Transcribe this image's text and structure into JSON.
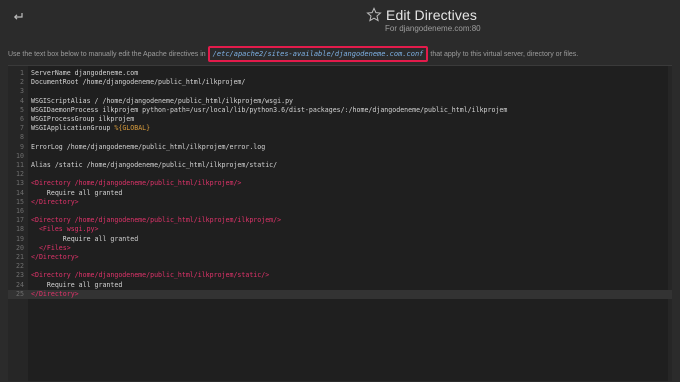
{
  "header": {
    "back_icon": "back-arrow-icon",
    "title": "Edit Directives",
    "star_icon": "star-outline-icon",
    "subtitle": "For djangodeneme.com:80"
  },
  "description": {
    "before": "Use the text box below to manually edit the Apache directives in",
    "path": "/etc/apache2/sites-available/djangodeneme.com.conf",
    "after": "that apply to this virtual server, directory or files."
  },
  "editor": {
    "lines": [
      {
        "n": "1",
        "text": "ServerName djangodeneme.com",
        "kind": "text"
      },
      {
        "n": "2",
        "text": "DocumentRoot /home/djangodeneme/public_html/ilkprojem/",
        "kind": "text"
      },
      {
        "n": "3",
        "text": "",
        "kind": "text"
      },
      {
        "n": "4",
        "text": "WSGIScriptAlias / /home/djangodeneme/public_html/ilkprojem/wsgi.py",
        "kind": "text"
      },
      {
        "n": "5",
        "text": "WSGIDaemonProcess ilkprojem python-path=/usr/local/lib/python3.6/dist-packages/:/home/djangodeneme/public_html/ilkprojem",
        "kind": "text"
      },
      {
        "n": "6",
        "text": "WSGIProcessGroup ilkprojem",
        "kind": "text"
      },
      {
        "n": "7",
        "text": "WSGIApplicationGroup ",
        "var": "%{GLOBAL}",
        "kind": "text"
      },
      {
        "n": "8",
        "text": "",
        "kind": "text"
      },
      {
        "n": "9",
        "text": "ErrorLog /home/djangodeneme/public_html/ilkprojem/error.log",
        "kind": "text"
      },
      {
        "n": "10",
        "text": "",
        "kind": "text"
      },
      {
        "n": "11",
        "text": "Alias /static /home/djangodeneme/public_html/ilkprojem/static/",
        "kind": "text"
      },
      {
        "n": "12",
        "text": "",
        "kind": "text"
      },
      {
        "n": "13",
        "text": "<Directory /home/djangodeneme/public_html/ilkprojem/>",
        "kind": "tag"
      },
      {
        "n": "14",
        "text": "    Require all granted",
        "kind": "text"
      },
      {
        "n": "15",
        "text": "</Directory>",
        "kind": "tag"
      },
      {
        "n": "16",
        "text": "",
        "kind": "text"
      },
      {
        "n": "17",
        "text": "<Directory /home/djangodeneme/public_html/ilkprojem/ilkprojem/>",
        "kind": "tag"
      },
      {
        "n": "18",
        "text": "  <Files wsgi.py>",
        "kind": "tag"
      },
      {
        "n": "19",
        "text": "        Require all granted",
        "kind": "text"
      },
      {
        "n": "20",
        "text": "  </Files>",
        "kind": "tag"
      },
      {
        "n": "21",
        "text": "</Directory>",
        "kind": "tag"
      },
      {
        "n": "22",
        "text": "",
        "kind": "text"
      },
      {
        "n": "23",
        "text": "<Directory /home/djangodeneme/public_html/ilkprojem/static/>",
        "kind": "tag"
      },
      {
        "n": "24",
        "text": "    Require all granted",
        "kind": "text"
      },
      {
        "n": "25",
        "text": "</Directory>",
        "kind": "tag",
        "active": true
      }
    ]
  },
  "colors": {
    "background": "#2b2b2b",
    "editor_bg": "#1f1f1f",
    "tag": "#e0336a",
    "variable": "#d59a3c",
    "path_highlight_border": "#e31b4b",
    "path_text": "#7fb2e6"
  }
}
